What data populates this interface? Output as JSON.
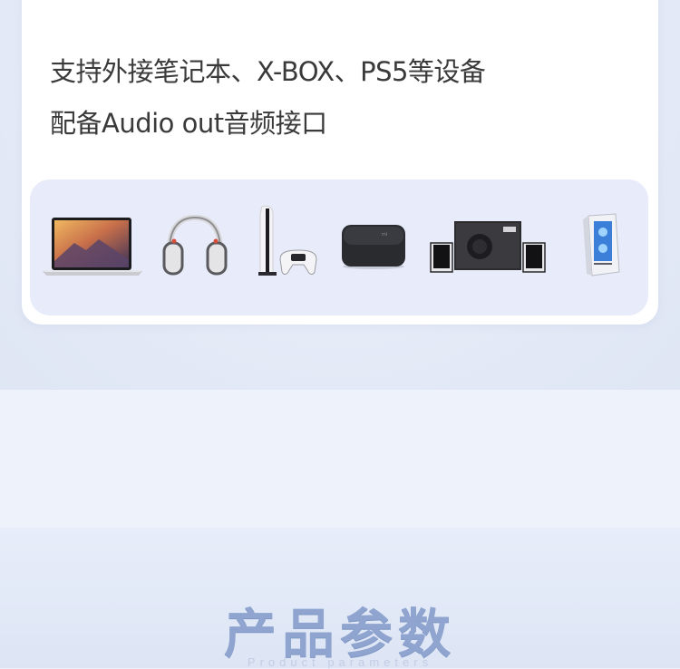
{
  "features": {
    "line1": "支持外接笔记本、X-BOX、PS5等设备",
    "line2": "配备Audio out音频接口"
  },
  "devices": [
    {
      "icon": "laptop-icon"
    },
    {
      "icon": "headphones-icon"
    },
    {
      "icon": "game-console-icon"
    },
    {
      "icon": "tv-box-icon"
    },
    {
      "icon": "speakers-icon"
    },
    {
      "icon": "desktop-pc-icon"
    }
  ],
  "params": {
    "title": "产品参数",
    "subtitle": "Product parameters"
  }
}
